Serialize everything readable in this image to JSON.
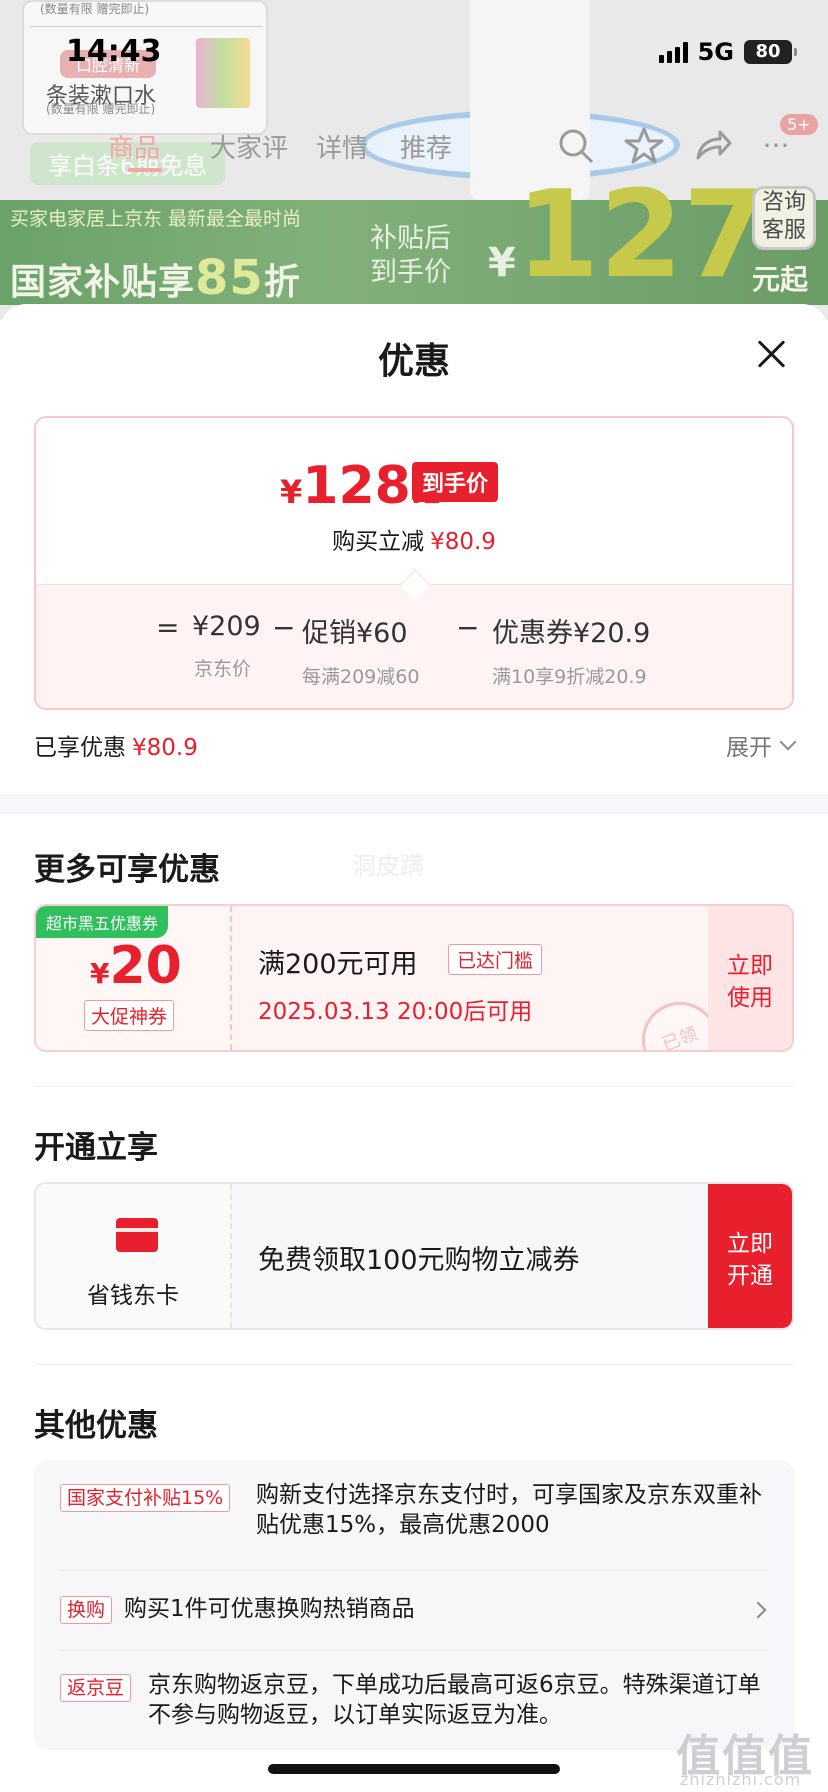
{
  "status_bar": {
    "time": "14:43",
    "network": "5G",
    "battery": "80"
  },
  "background": {
    "thumb_small": "(数量有限 赠完即止)",
    "thumb_tag": "口腔清新",
    "thumb_title": "条装漱口水",
    "thumb_sub": "(数量有限 赠完即止)",
    "promo_pill": "享白条6期免息",
    "tabs": [
      "商品",
      "大家评",
      "详情",
      "推荐"
    ],
    "cart_badge": "5+",
    "banner_small": "买家电家居上京东 最新最全最时尚",
    "banner_main_prefix": "国家补贴享",
    "banner_main_num": "85",
    "banner_main_suffix": "折",
    "banner_sub_1": "补贴后",
    "banner_sub_2": "到手价",
    "banner_currency": "¥",
    "banner_price": "127",
    "banner_consult": "咨询客服",
    "banner_from": "元起"
  },
  "sheet": {
    "title": "优惠",
    "price_card": {
      "currency": "¥",
      "price_int": "128",
      "price_dec": ".1",
      "final_tag": "到手价",
      "reduce_label": "购买立减",
      "reduce_value": "¥80.9",
      "eq": "=",
      "minus": "−",
      "jd_price": "¥209",
      "jd_price_label": "京东价",
      "promo": "促销¥60",
      "promo_desc": "每满209减60",
      "coupon": "优惠券¥20.9",
      "coupon_desc": "满10享9折减20.9"
    },
    "enjoyed": {
      "label": "已享优惠",
      "value": "¥80.9",
      "expand": "展开"
    },
    "more_title": "更多可享优惠",
    "faded_text": "洞皮蹒",
    "coupon": {
      "badge": "超市黑五优惠券",
      "currency": "¥",
      "amount": "20",
      "type": "大促神券",
      "condition": "满200元可用",
      "reached": "已达门槛",
      "time": "2025.03.13 20:00后可用",
      "use_button": "立即使用",
      "stamp": "已领"
    },
    "open_title": "开通立享",
    "member": {
      "name": "省钱东卡",
      "desc": "免费领取100元购物立减券",
      "open_button": "立即开通"
    },
    "other_title": "其他优惠",
    "others": [
      {
        "tag": "国家支付补贴15%",
        "text": "购新支付选择京东支付时，可享国家及京东双重补贴优惠15%，最高优惠2000"
      },
      {
        "tag": "换购",
        "text": "购买1件可优惠换购热销商品"
      },
      {
        "tag": "返京豆",
        "text": "京东购物返京豆，下单成功后最高可返6京豆。特殊渠道订单不参与购物返豆，以订单实际返豆为准。"
      }
    ]
  },
  "watermark": {
    "main": "值值值",
    "sub": "zhizhizhi.com"
  }
}
